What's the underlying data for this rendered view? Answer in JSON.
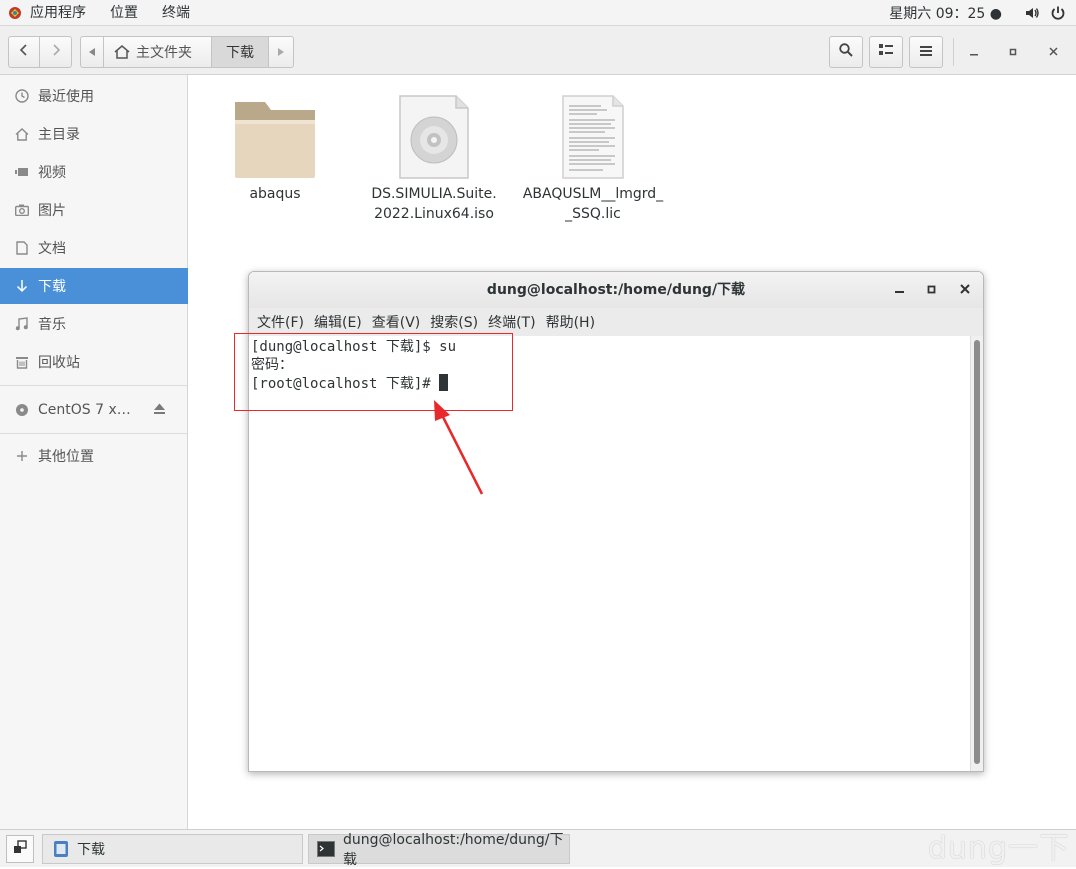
{
  "top_panel": {
    "apps_label": "应用程序",
    "places_label": "位置",
    "terminal_label": "终端",
    "clock": "星期六 09：25 ●"
  },
  "file_manager": {
    "breadcrumb": {
      "home": "主文件夹",
      "current": "下载"
    },
    "sidebar": {
      "items": [
        {
          "label": "最近使用",
          "icon": "clock-icon"
        },
        {
          "label": "主目录",
          "icon": "home-icon"
        },
        {
          "label": "视频",
          "icon": "video-icon"
        },
        {
          "label": "图片",
          "icon": "camera-icon"
        },
        {
          "label": "文档",
          "icon": "document-icon"
        },
        {
          "label": "下载",
          "icon": "download-icon",
          "active": true
        },
        {
          "label": "音乐",
          "icon": "music-icon"
        },
        {
          "label": "回收站",
          "icon": "trash-icon"
        },
        {
          "label": "CentOS 7 x…",
          "icon": "disc-icon"
        },
        {
          "label": "其他位置",
          "icon": "plus-icon"
        }
      ]
    },
    "files": [
      {
        "line1": "abaqus",
        "line2": "",
        "icon": "folder-icon"
      },
      {
        "line1": "DS.SIMULIA.Suite.",
        "line2": "2022.Linux64.iso",
        "icon": "disc-image-icon"
      },
      {
        "line1": "ABAQUSLM__lmgrd_",
        "line2": "_SSQ.lic",
        "icon": "text-file-icon"
      }
    ]
  },
  "terminal": {
    "title": "dung@localhost:/home/dung/下载",
    "menu": [
      "文件(F)",
      "编辑(E)",
      "查看(V)",
      "搜索(S)",
      "终端(T)",
      "帮助(H)"
    ],
    "lines": [
      "[dung@localhost 下载]$ su",
      "密码：",
      "[root@localhost 下载]# "
    ]
  },
  "taskbar": {
    "items": [
      "下载",
      "dung@localhost:/home/dung/下载"
    ],
    "watermark": "dung一下"
  },
  "colors": {
    "accent": "#4a90d9",
    "annotation": "#e8292b"
  }
}
